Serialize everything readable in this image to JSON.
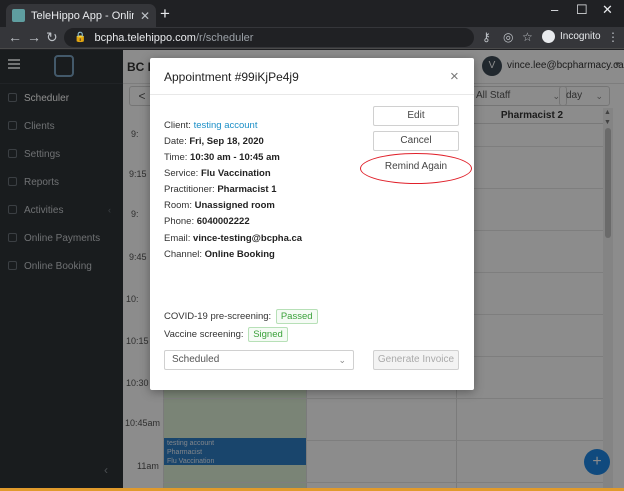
{
  "browser": {
    "tab_title": "TeleHippo App - Online booking",
    "tab_close": "✕",
    "new_tab": "+",
    "url_host": "bcpha.telehippo.com",
    "url_path": "/r/scheduler",
    "incognito_label": "Incognito"
  },
  "sidebar": {
    "items": [
      {
        "label": "Scheduler"
      },
      {
        "label": "Clients"
      },
      {
        "label": "Settings"
      },
      {
        "label": "Reports"
      },
      {
        "label": "Activities"
      },
      {
        "label": "Online Payments"
      },
      {
        "label": "Online Booking"
      }
    ],
    "collapse_glyph": "‹"
  },
  "topbar": {
    "brand": "BC P",
    "user_initial": "V",
    "user_email": "vince.lee@bcpharmacy.ca"
  },
  "toolbar": {
    "prev": "<",
    "staff_filter": "All Staff",
    "view": "day"
  },
  "calendar": {
    "column_header": "Pharmacist 2",
    "times": [
      "9:",
      "9:15",
      "9:",
      "9:45",
      "10:",
      "10:15",
      "10:30",
      "10:45am",
      "11am"
    ],
    "appt_lines": [
      "testing account",
      "Pharmacist",
      "Flu Vaccination"
    ]
  },
  "modal": {
    "title": "Appointment #99iKjPe4j9",
    "close": "×",
    "client_label": "Client:",
    "client_value": "testing account",
    "date_label": "Date:",
    "date_value": "Fri, Sep 18, 2020",
    "time_label": "Time:",
    "time_value": "10:30 am - 10:45 am",
    "service_label": "Service:",
    "service_value": "Flu Vaccination",
    "practitioner_label": "Practitioner:",
    "practitioner_value": "Pharmacist 1",
    "room_label": "Room:",
    "room_value": "Unassigned room",
    "phone_label": "Phone:",
    "phone_value": "6040002222",
    "email_label": "Email:",
    "email_value": "vince-testing@bcpha.ca",
    "channel_label": "Channel:",
    "channel_value": "Online Booking",
    "covid_label": "COVID-19 pre-screening:",
    "covid_status": "Passed",
    "vaccine_label": "Vaccine screening:",
    "vaccine_status": "Signed",
    "status_value": "Scheduled",
    "buttons": {
      "edit": "Edit",
      "cancel": "Cancel",
      "remind": "Remind Again",
      "invoice": "Generate Invoice"
    }
  },
  "colors": {
    "accent": "#1e88e5",
    "highlight_ring": "#e0202a",
    "passed_green": "#3aa13a"
  }
}
